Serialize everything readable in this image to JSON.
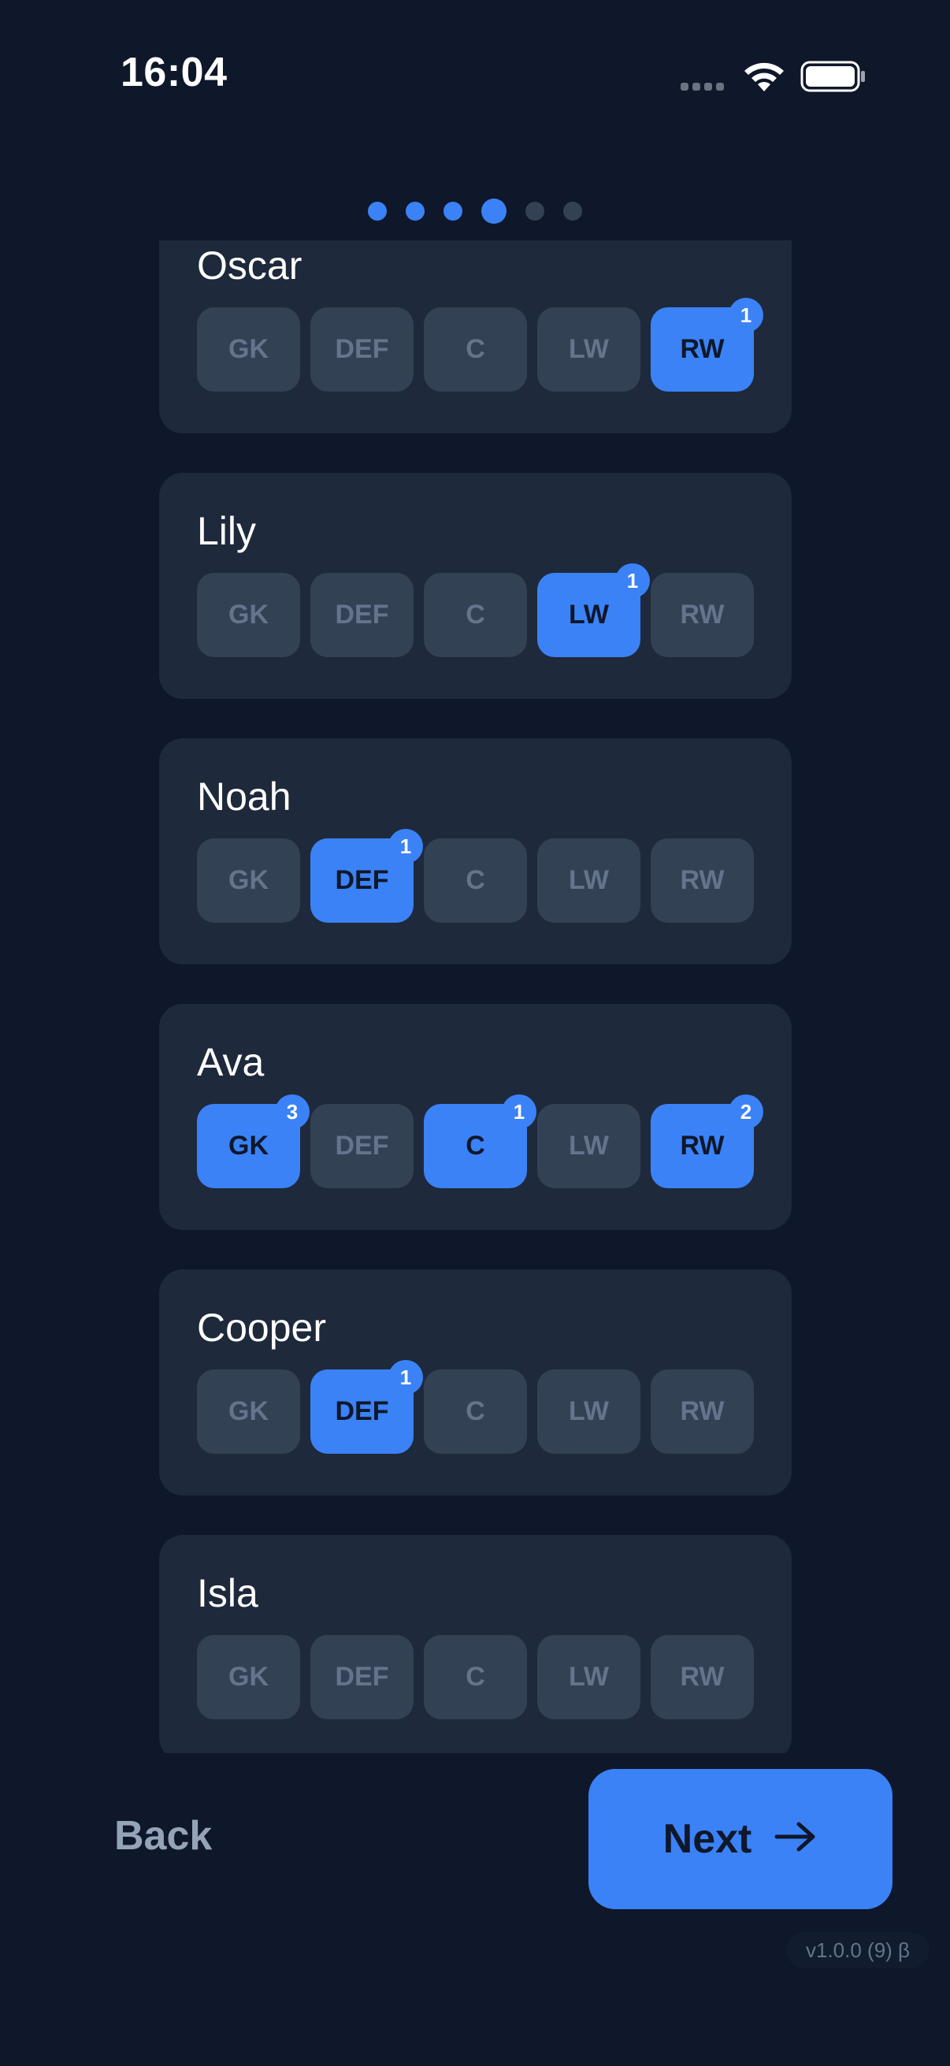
{
  "status_bar": {
    "time": "16:04"
  },
  "pager": {
    "dots": [
      "done",
      "done",
      "done",
      "active",
      "pending",
      "pending"
    ]
  },
  "positions": [
    "GK",
    "DEF",
    "C",
    "LW",
    "RW"
  ],
  "players": [
    {
      "name": "Oscar",
      "selected": {
        "RW": 1
      }
    },
    {
      "name": "Lily",
      "selected": {
        "LW": 1
      }
    },
    {
      "name": "Noah",
      "selected": {
        "DEF": 1
      }
    },
    {
      "name": "Ava",
      "selected": {
        "GK": 3,
        "C": 1,
        "RW": 2
      }
    },
    {
      "name": "Cooper",
      "selected": {
        "DEF": 1
      }
    },
    {
      "name": "Isla",
      "selected": {}
    }
  ],
  "footer": {
    "back_label": "Back",
    "next_label": "Next",
    "version": "v1.0.0 (9) β"
  },
  "colors": {
    "background": "#0f172a",
    "card": "#1e293b",
    "accent": "#3b82f6",
    "inactive_button": "#334155"
  },
  "icons": {
    "wifi": "wifi-icon",
    "battery": "battery-icon",
    "cellular": "cellular-signal-icon",
    "next": "arrow-right-icon"
  }
}
